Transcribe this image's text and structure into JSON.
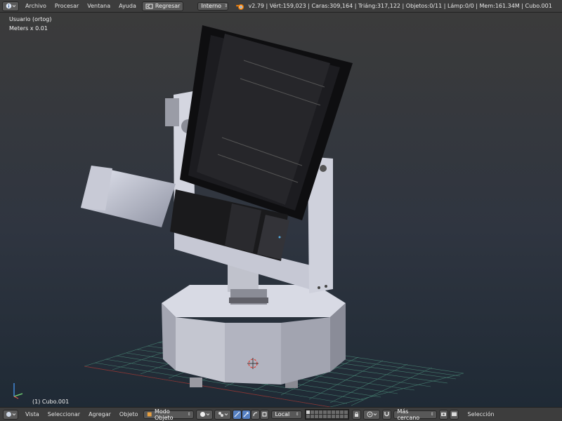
{
  "topbar": {
    "info_icon": "info-icon",
    "menus": [
      "Archivo",
      "Procesar",
      "Ventana",
      "Ayuda"
    ],
    "back_button": {
      "icon": "back-screen-icon",
      "label": "Regresar"
    },
    "engine": "Interno",
    "blender_icon": "blender-logo-icon",
    "stats": "v2.79 | Vért:159,023 | Caras:309,164 | Triáng:317,122 | Objetos:0/11 | Lámp:0/0 | Mem:161.34M | Cubo.001"
  },
  "viewport": {
    "view_name": "Usuario (ortog)",
    "scale": "Meters x 0.01",
    "active_object": "(1) Cubo.001",
    "colors": {
      "background_top": "#3b3b3b",
      "background_bottom": "#1f2a35",
      "grid": "#4a8a78",
      "cursor": "#e23a2e"
    }
  },
  "bottombar": {
    "editor_icon": "3d-view-icon",
    "menus": [
      "Vista",
      "Seleccionar",
      "Agregar",
      "Objeto"
    ],
    "mode": "Modo Objeto",
    "shading_icon": "solid-shading-icon",
    "pivot_icon": "pivot-point-icon",
    "manipulator_icons": [
      "manipulator-toggle-icon",
      "translate-icon",
      "rotate-icon",
      "scale-icon"
    ],
    "orientation": "Local",
    "layers_icon": "layers-grid-icon",
    "lock_icon": "lock-camera-icon",
    "proportional_icon": "proportional-edit-icon",
    "snap_icon": "snap-magnet-icon",
    "snap_target": "Más cercano",
    "render_icons": [
      "render-still-icon",
      "render-animation-icon"
    ],
    "selection_label": "Selección"
  }
}
